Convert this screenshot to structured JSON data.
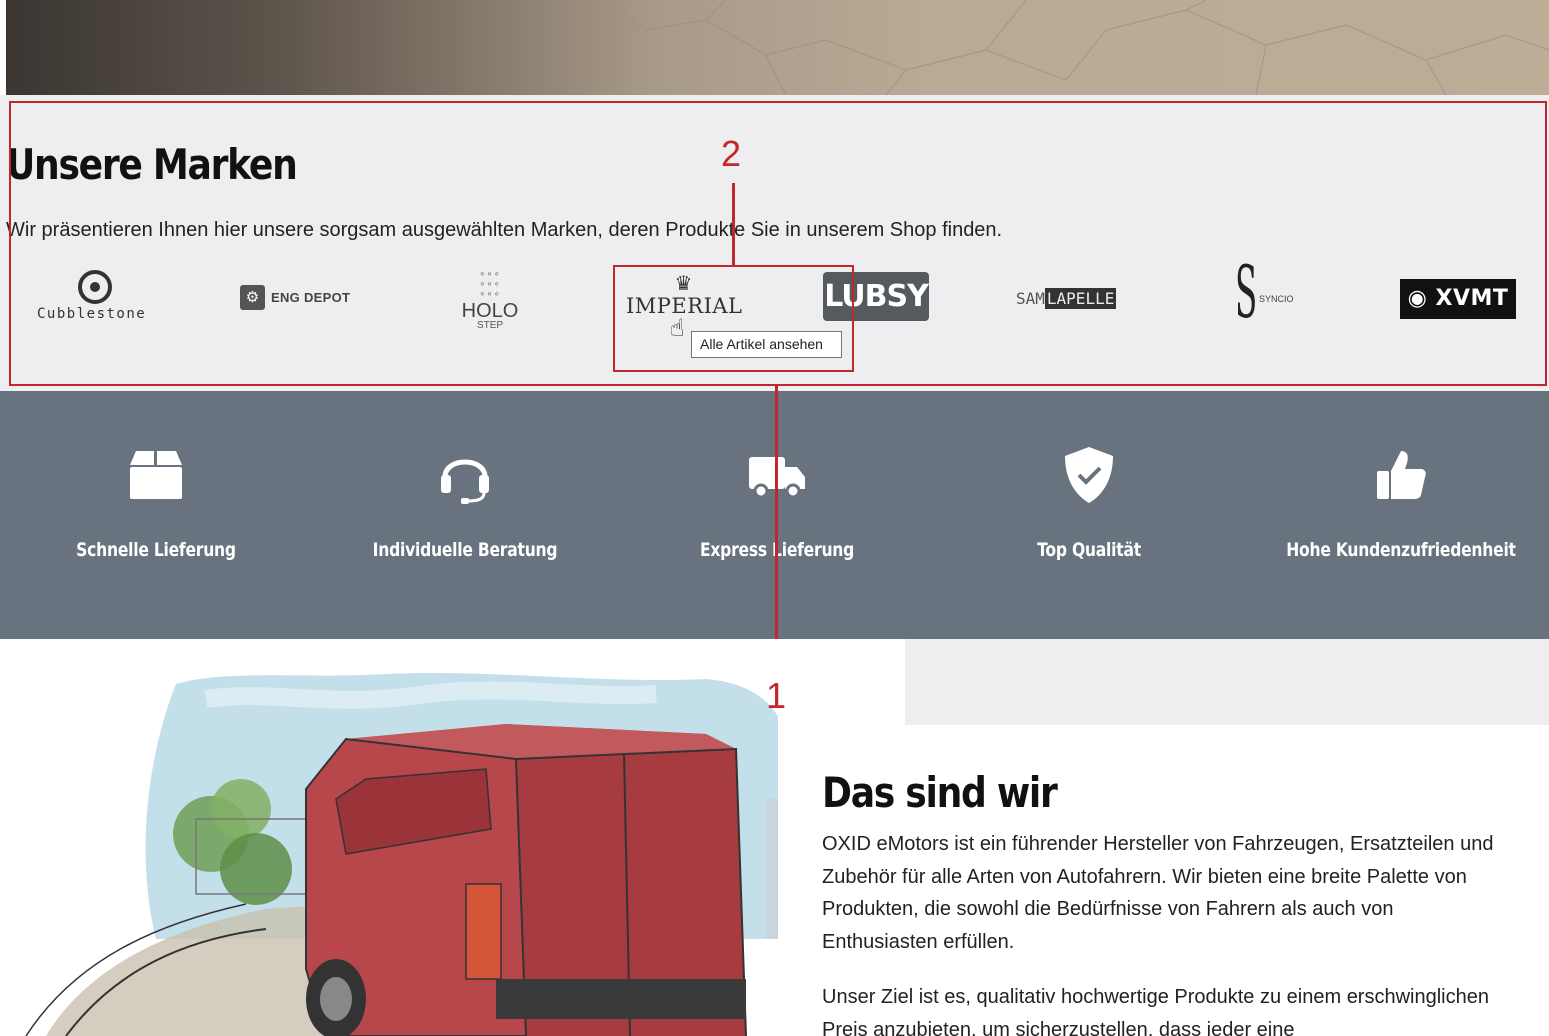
{
  "brands": {
    "title": "Unsere Marken",
    "description": "Wir präsentieren Ihnen hier unsere sorgsam ausgewählten Marken, deren Produkte Sie in unserem Shop finden.",
    "logos": {
      "cubblestone": "Cubblestone",
      "eng_depot": "ENG DEPOT",
      "holo": "HOLO",
      "holo_sub": "STEP",
      "imperial": "IMPERIAL",
      "lubsy": "LUBSY",
      "sam": "SAM",
      "lapelle": "LAPELLE",
      "syncio": "SYNCIO",
      "xvmt": "XVMT"
    },
    "tooltip": "Alle Artikel ansehen"
  },
  "annotations": {
    "label_1": "1",
    "label_2": "2",
    "color": "#c0282d"
  },
  "features": [
    {
      "label": "Schnelle Lieferung",
      "icon": "box-icon"
    },
    {
      "label": "Individuelle Beratung",
      "icon": "headset-icon"
    },
    {
      "label": "Express Lieferung",
      "icon": "truck-icon"
    },
    {
      "label": "Top Qualität",
      "icon": "shield-check-icon"
    },
    {
      "label": "Hohe Kundenzufriedenheit",
      "icon": "thumbs-up-icon"
    }
  ],
  "about": {
    "title": "Das sind wir",
    "paragraph_1": "OXID eMotors ist ein führender Hersteller von Fahrzeugen, Ersatzteilen und Zubehör für alle Arten von Autofahrern. Wir bieten eine breite Palette von Produkten, die sowohl die Bedürfnisse von Fahrern als auch von Enthusiasten erfüllen.",
    "paragraph_2": "Unser Ziel ist es, qualitativ hochwertige Produkte zu einem erschwinglichen Preis anzubieten, um sicherzustellen, dass jeder eine"
  },
  "colors": {
    "features_bg": "#68737f",
    "section_bg": "#eeeef0",
    "van": "#b8474b"
  }
}
